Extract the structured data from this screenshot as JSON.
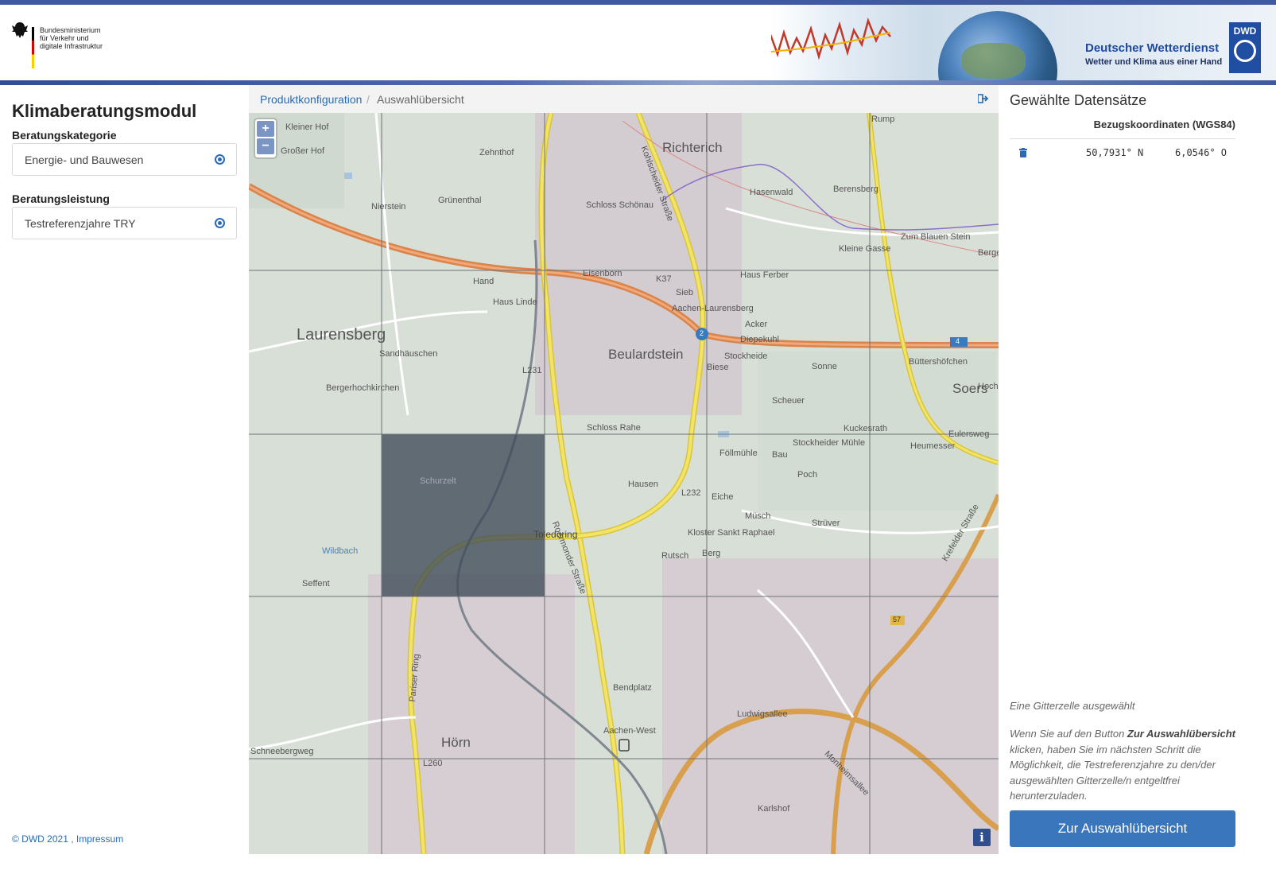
{
  "header": {
    "ministry_line1": "Bundesministerium",
    "ministry_line2": "für Verkehr und",
    "ministry_line3": "digitale Infrastruktur",
    "dwd_title": "Deutscher Wetterdienst",
    "dwd_subtitle": "Wetter und Klima aus einer Hand",
    "dwd_logo_text": "DWD"
  },
  "sidebar": {
    "title": "Klimaberatungsmodul",
    "category_label": "Beratungskategorie",
    "category_value": "Energie- und Bauwesen",
    "service_label": "Beratungsleistung",
    "service_value": "Testreferenzjahre TRY",
    "footer_copyright": "© DWD 2021 ,",
    "footer_link": "Impressum"
  },
  "breadcrumb": {
    "items": [
      "Produktkonfiguration",
      "Auswahlübersicht"
    ],
    "separator": "/"
  },
  "map": {
    "zoom_in": "+",
    "zoom_out": "−",
    "info": "i",
    "labels": {
      "laurensberg": "Laurensberg",
      "richterich": "Richterich",
      "beulardstein": "Beulardstein",
      "soers": "Soers",
      "hoern": "Hörn",
      "kleiner_hof": "Kleiner Hof",
      "grosser_hof": "Großer Hof",
      "zehnthof": "Zehnthof",
      "nierstein": "Nierstein",
      "gruenenthal": "Grünenthal",
      "schloss_schoenau": "Schloss Schönau",
      "hasenwald": "Hasenwald",
      "berensberg": "Berensberg",
      "kleine_gasse": "Kleine Gasse",
      "hand": "Hand",
      "haus_linde": "Haus Linde",
      "haus_ferber": "Haus Ferber",
      "sieb": "Sieb",
      "aachen_laurensberg": "Aachen-Laurensberg",
      "acker": "Acker",
      "sandhaeuschen": "Sandhäuschen",
      "bergerhochkirchen": "Bergerhochkirchen",
      "stockheide": "Stockheide",
      "sonne": "Sonne",
      "buttershofchen": "Büttershöfchen",
      "biese": "Biese",
      "scheuer": "Scheuer",
      "kuckesrath": "Kuckesrath",
      "heumesser": "Heumesser",
      "schloss_rahe": "Schloss Rahe",
      "follmuhle": "Föllmühle",
      "bau": "Bau",
      "stockheider_muhle": "Stockheider Mühle",
      "poch": "Poch",
      "hausen": "Hausen",
      "eiche": "Eiche",
      "muesch": "Müsch",
      "struever": "Strüver",
      "kloster": "Kloster Sankt Raphael",
      "rutsch": "Rutsch",
      "berg": "Berg",
      "seffent": "Seffent",
      "schurzelt": "Schurzelt",
      "toledoring": "Toledoring",
      "bendplatz": "Bendplatz",
      "aachen_west": "Aachen-West",
      "karlshof": "Karlshof",
      "ludwigsallee": "Ludwigsallee",
      "pariser_ring": "Pariser Ring",
      "schneebergweg": "Schneebergweg",
      "roermonder": "Roermonder Straße",
      "kohlscheider": "Kohlscheider Straße",
      "eulersweg": "Eulersweg",
      "zum_blauen_stein": "Zum Blauen Stein",
      "bergerbusch": "Bergerbusch",
      "hochbr": "Hochbr",
      "rumpen": "Rump",
      "diepekuhl": "Diepekuhl",
      "eisenborn": "Eisenborn",
      "k37": "K37",
      "l231": "L231",
      "l232": "L232",
      "l260": "L260",
      "a4": "4",
      "exit2": "2",
      "b57": "57",
      "wildbach": "Wildbach",
      "krefelder": "Krefelder Straße",
      "monheimsallee": "Monheimsallee"
    }
  },
  "panel": {
    "title": "Gewählte Datensätze",
    "column_header": "Bezugskoordinaten (WGS84)",
    "rows": [
      {
        "lat": "50,7931° N",
        "lon": "6,0546° O"
      }
    ],
    "selection_note": "Eine Gitterzelle ausgewählt",
    "hint_part1": "Wenn Sie auf den Button ",
    "hint_bold": "Zur Auswahlübersicht",
    "hint_part2": " klicken, haben Sie im nächsten Schritt die Möglichkeit, die Testreferenzjahre zu den/der ausgewählten Gitterzelle/n entgeltfrei herunterzuladen.",
    "button_label": "Zur Auswahlübersicht"
  },
  "colors": {
    "accent": "#3a76bb",
    "header_blue": "#3f5a9e",
    "selected_cell": "#3d4a58"
  }
}
